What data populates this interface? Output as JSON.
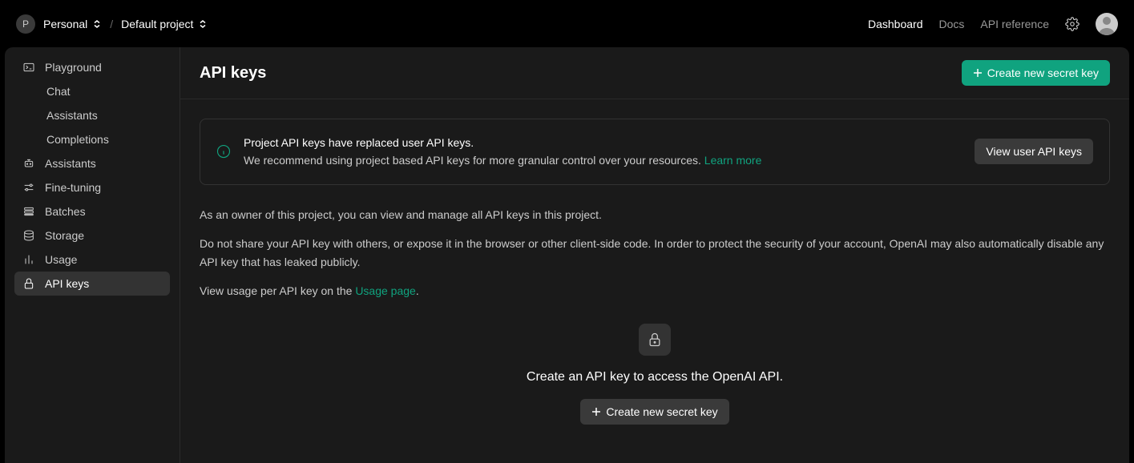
{
  "header": {
    "org_letter": "P",
    "org_name": "Personal",
    "project_name": "Default project",
    "nav": {
      "dashboard": "Dashboard",
      "docs": "Docs",
      "api_reference": "API reference"
    }
  },
  "sidebar": {
    "playground": "Playground",
    "chat": "Chat",
    "assistants_sub": "Assistants",
    "completions": "Completions",
    "assistants": "Assistants",
    "fine_tuning": "Fine-tuning",
    "batches": "Batches",
    "storage": "Storage",
    "usage": "Usage",
    "api_keys": "API keys"
  },
  "page": {
    "title": "API keys",
    "create_button": "Create new secret key",
    "info": {
      "title": "Project API keys have replaced user API keys.",
      "body": "We recommend using project based API keys for more granular control over your resources. ",
      "learn_more": "Learn more",
      "view_user_keys": "View user API keys"
    },
    "p1": "As an owner of this project, you can view and manage all API keys in this project.",
    "p2": "Do not share your API key with others, or expose it in the browser or other client-side code. In order to protect the security of your account, OpenAI may also automatically disable any API key that has leaked publicly.",
    "p3_prefix": "View usage per API key on the ",
    "p3_link": "Usage page",
    "p3_suffix": ".",
    "empty": {
      "text": "Create an API key to access the OpenAI API.",
      "button": "Create new secret key"
    }
  }
}
